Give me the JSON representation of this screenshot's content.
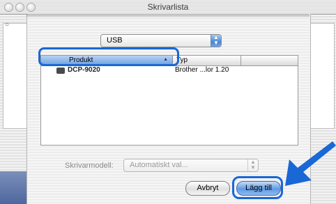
{
  "window": {
    "title": "Skrivarlista"
  },
  "connection": {
    "selected": "USB"
  },
  "list": {
    "columns": [
      "Produkt",
      "Typ"
    ],
    "rows": [
      {
        "name": "DCP-9020",
        "type": "Brother ...lor 1.20"
      }
    ]
  },
  "printer_model": {
    "label": "Skrivarmodell:",
    "value": "Automatiskt val..."
  },
  "buttons": {
    "cancel": "Avbryt",
    "add": "Lägg till"
  },
  "colors": {
    "highlight": "#1a67d6",
    "accent": "#4a87d4"
  }
}
